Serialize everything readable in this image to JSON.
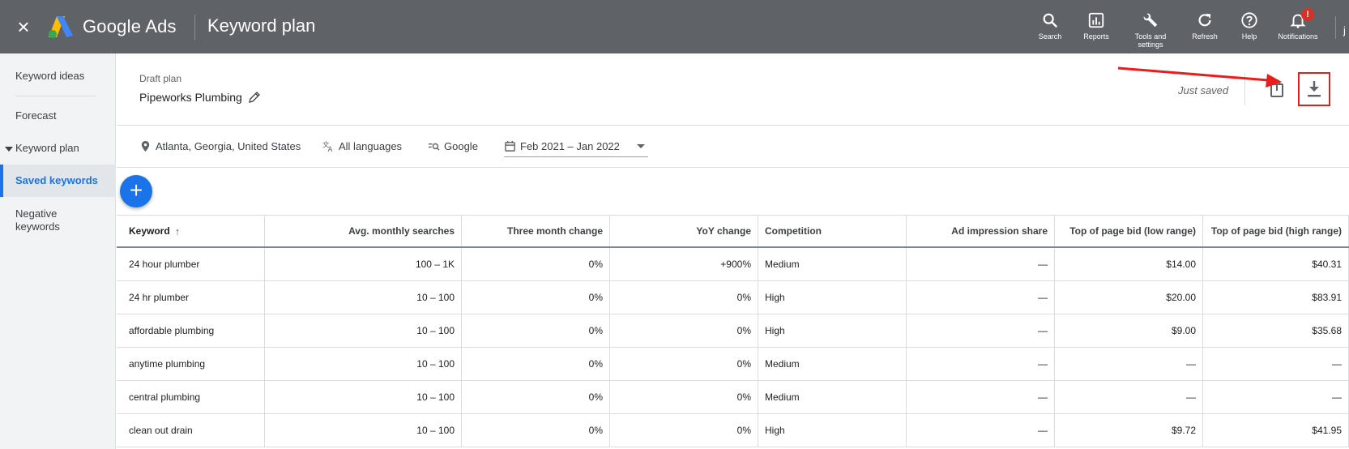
{
  "topbar": {
    "brand": "Google Ads",
    "page": "Keyword plan",
    "tools": [
      {
        "label": "Search",
        "icon": "search-icon"
      },
      {
        "label": "Reports",
        "icon": "reports-icon"
      },
      {
        "label": "Tools and settings",
        "icon": "wrench-icon"
      },
      {
        "label": "Refresh",
        "icon": "refresh-icon"
      },
      {
        "label": "Help",
        "icon": "help-icon"
      },
      {
        "label": "Notifications",
        "icon": "bell-icon",
        "badge": "!"
      }
    ],
    "account_initial": "j"
  },
  "sidebar": {
    "items": [
      {
        "label": "Keyword ideas"
      },
      {
        "label": "Forecast"
      },
      {
        "label": "Keyword plan"
      },
      {
        "label": "Saved keywords",
        "active": true
      },
      {
        "label": "Negative keywords"
      }
    ]
  },
  "plan": {
    "draft_label": "Draft plan",
    "name": "Pipeworks Plumbing",
    "status": "Just saved"
  },
  "filters": {
    "location": "Atlanta, Georgia, United States",
    "language": "All languages",
    "network": "Google",
    "date_range": "Feb 2021 – Jan 2022"
  },
  "table": {
    "headers": [
      "Keyword",
      "Avg. monthly searches",
      "Three month change",
      "YoY change",
      "Competition",
      "Ad impression share",
      "Top of page bid (low range)",
      "Top of page bid (high range)"
    ],
    "rows": [
      [
        "24 hour plumber",
        "100 – 1K",
        "0%",
        "+900%",
        "Medium",
        "—",
        "$14.00",
        "$40.31"
      ],
      [
        "24 hr plumber",
        "10 – 100",
        "0%",
        "0%",
        "High",
        "—",
        "$20.00",
        "$83.91"
      ],
      [
        "affordable plumbing",
        "10 – 100",
        "0%",
        "0%",
        "High",
        "—",
        "$9.00",
        "$35.68"
      ],
      [
        "anytime plumbing",
        "10 – 100",
        "0%",
        "0%",
        "Medium",
        "—",
        "—",
        "—"
      ],
      [
        "central plumbing",
        "10 – 100",
        "0%",
        "0%",
        "Medium",
        "—",
        "—",
        "—"
      ],
      [
        "clean out drain",
        "10 – 100",
        "0%",
        "0%",
        "High",
        "—",
        "$9.72",
        "$41.95"
      ]
    ]
  },
  "colors": {
    "topbar": "#5f6368",
    "accent": "#1a73e8",
    "annotation": "#ea1c1c"
  }
}
